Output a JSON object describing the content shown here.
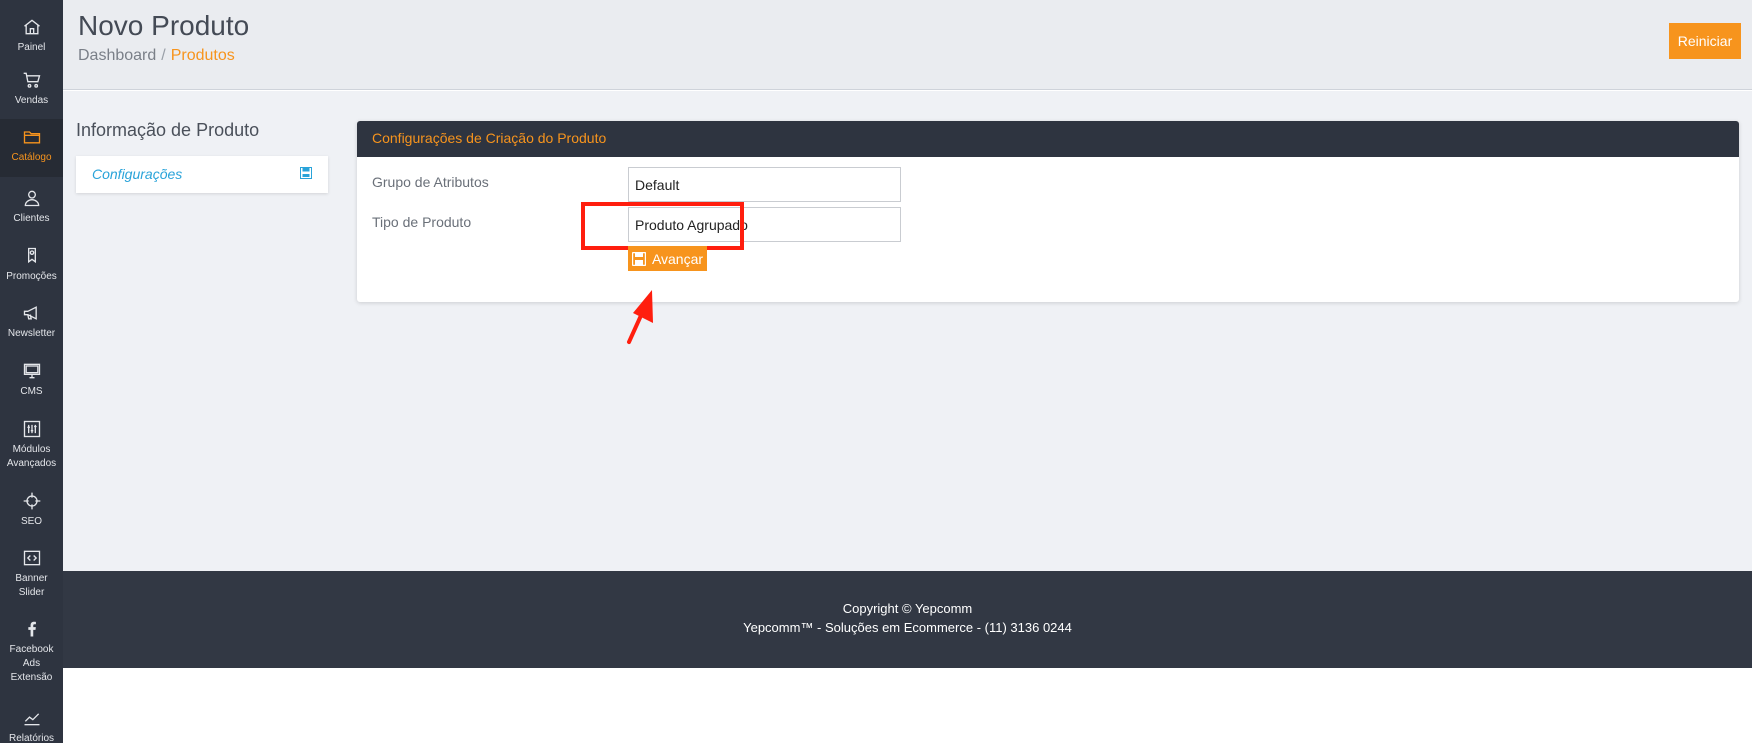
{
  "sidebar": {
    "items": [
      {
        "label": "Painel",
        "icon": "home-icon",
        "active": false
      },
      {
        "label": "Vendas",
        "icon": "cart-icon",
        "active": false
      },
      {
        "label": "Catálogo",
        "icon": "folder-icon",
        "active": true
      },
      {
        "label": "Clientes",
        "icon": "user-icon",
        "active": false
      },
      {
        "label": "Promoções",
        "icon": "ribbon-icon",
        "active": false
      },
      {
        "label": "Newsletter",
        "icon": "megaphone-icon",
        "active": false
      },
      {
        "label": "CMS",
        "icon": "monitor-icon",
        "active": false
      },
      {
        "label": "Módulos\nAvançados",
        "icon": "sliders-icon",
        "active": false
      },
      {
        "label": "SEO",
        "icon": "crosshair-icon",
        "active": false
      },
      {
        "label": "Banner\nSlider",
        "icon": "code-icon",
        "active": false
      },
      {
        "label": "Facebook\nAds\nExtensão",
        "icon": "facebook-icon",
        "active": false
      },
      {
        "label": "Relatórios",
        "icon": "trend-icon",
        "active": false
      }
    ]
  },
  "header": {
    "title": "Novo Produto",
    "breadcrumb": {
      "home": "Dashboard",
      "separator": "/",
      "current": "Produtos"
    },
    "reset_label": "Reiniciar"
  },
  "side": {
    "title": "Informação de Produto",
    "link": "Configurações"
  },
  "panel": {
    "title": "Configurações de Criação do Produto",
    "fields": {
      "attribute_group": {
        "label": "Grupo de Atributos",
        "value": "Default"
      },
      "product_type": {
        "label": "Tipo de Produto",
        "value": "Produto Agrupado"
      }
    },
    "advance_label": "Avançar"
  },
  "footer": {
    "copyright": "Copyright © Yepcomm",
    "tagline": "Yepcomm™ - Soluções em Ecommerce - (11) 3136 0244"
  },
  "colors": {
    "accent": "#f7941d",
    "sidebar_bg": "#2e3440",
    "annotation": "#ff1e0e",
    "link": "#29a3d9"
  }
}
